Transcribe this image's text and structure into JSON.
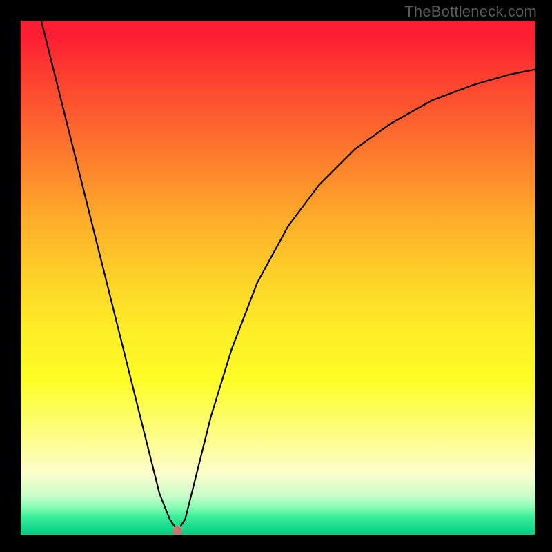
{
  "watermark": "TheBottleneck.com",
  "chart_data": {
    "type": "line",
    "title": "",
    "xlabel": "",
    "ylabel": "",
    "xlim": [
      0,
      100
    ],
    "ylim": [
      0,
      100
    ],
    "series": [
      {
        "name": "bottleneck-curve",
        "x": [
          4,
          5,
          6,
          8,
          10,
          13,
          16,
          19,
          22,
          25,
          27,
          29,
          30.5,
          32,
          34,
          37,
          41,
          46,
          52,
          58,
          65,
          72,
          80,
          88,
          95,
          100
        ],
        "values": [
          100,
          96,
          92,
          84,
          76,
          64,
          52,
          40,
          28,
          16,
          8,
          3,
          0.8,
          3,
          11,
          23,
          36,
          49,
          60,
          68,
          75,
          80,
          84.5,
          87.5,
          89.5,
          90.5
        ]
      }
    ],
    "marker": {
      "x": 30.5,
      "y": 0.8,
      "color": "#c77a6f"
    }
  },
  "colors": {
    "frame": "#000000",
    "watermark": "#595959",
    "curve": "#000000",
    "marker": "#c77a6f"
  }
}
